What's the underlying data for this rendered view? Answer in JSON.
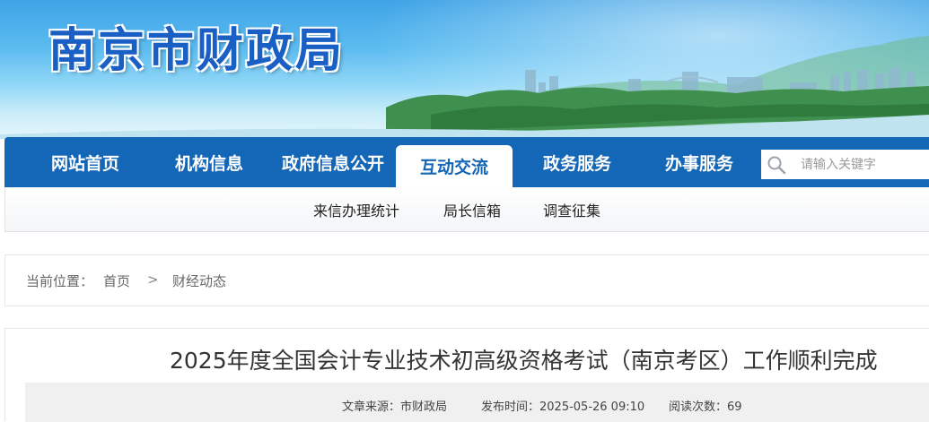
{
  "site": {
    "title": "南京市财政局"
  },
  "nav": {
    "items": [
      {
        "label": "网站首页"
      },
      {
        "label": "机构信息"
      },
      {
        "label": "政府信息公开"
      },
      {
        "label": "互动交流",
        "active": true
      },
      {
        "label": "政务服务"
      },
      {
        "label": "办事服务"
      }
    ],
    "search_placeholder": "请输入关键字"
  },
  "subnav": {
    "items": [
      {
        "label": "来信办理统计"
      },
      {
        "label": "局长信箱"
      },
      {
        "label": "调查征集"
      }
    ]
  },
  "breadcrumb": {
    "prefix": "当前位置：",
    "home": "首页",
    "separator": ">",
    "current": "财经动态"
  },
  "article": {
    "title": "2025年度全国会计专业技术初高级资格考试（南京考区）工作顺利完成",
    "source": "文章来源：市财政局",
    "published": "发布时间：2025-05-26 09:10",
    "views": "阅读次数：69"
  },
  "colors": {
    "nav_bg": "#1466b6",
    "title_blue": "#1a5fc4"
  }
}
